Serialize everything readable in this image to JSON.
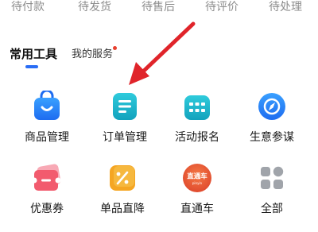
{
  "order_status_tabs": [
    "待付款",
    "待发货",
    "待售后",
    "待评价",
    "待处理"
  ],
  "tool_tabs": {
    "active": "常用工具",
    "other": "我的服务"
  },
  "tools": [
    {
      "label": "商品管理",
      "icon": "shopping-bag-icon"
    },
    {
      "label": "订单管理",
      "icon": "order-document-icon"
    },
    {
      "label": "活动报名",
      "icon": "calendar-register-icon"
    },
    {
      "label": "生意参谋",
      "icon": "compass-icon"
    },
    {
      "label": "优惠券",
      "icon": "coupon-ticket-icon"
    },
    {
      "label": "单品直降",
      "icon": "price-drop-tag-icon"
    },
    {
      "label": "直通车",
      "icon": "ztc-badge-icon",
      "badge_text": "直通车",
      "badge_sub": "pinyin"
    },
    {
      "label": "全部",
      "icon": "all-apps-grid-icon"
    }
  ],
  "colors": {
    "accent_blue": "#2a6df5",
    "arrow_red": "#e0242a",
    "cyan": "#1bb1c9",
    "coupon_red": "#f25b6e",
    "orange": "#f5a623",
    "ztc_red": "#e8593a",
    "gray_icon": "#9aa0a6"
  }
}
